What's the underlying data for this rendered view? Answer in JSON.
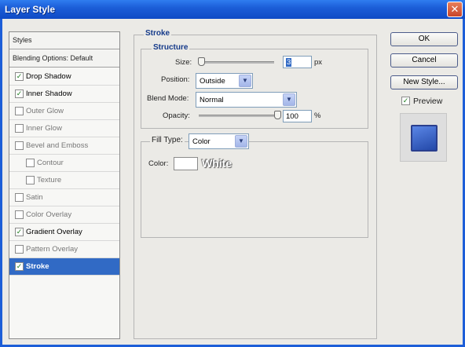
{
  "window": {
    "title": "Layer Style"
  },
  "styles_list": {
    "header": "Styles",
    "blending": "Blending Options: Default",
    "items": [
      {
        "label": "Drop Shadow",
        "checked": true
      },
      {
        "label": "Inner Shadow",
        "checked": true
      },
      {
        "label": "Outer Glow",
        "checked": false
      },
      {
        "label": "Inner Glow",
        "checked": false
      },
      {
        "label": "Bevel and Emboss",
        "checked": false
      },
      {
        "label": "Contour",
        "checked": false
      },
      {
        "label": "Texture",
        "checked": false
      },
      {
        "label": "Satin",
        "checked": false
      },
      {
        "label": "Color Overlay",
        "checked": false
      },
      {
        "label": "Gradient Overlay",
        "checked": true
      },
      {
        "label": "Pattern Overlay",
        "checked": false
      },
      {
        "label": "Stroke",
        "checked": true,
        "selected": true
      }
    ]
  },
  "stroke": {
    "section_title": "Stroke",
    "structure_title": "Structure",
    "size_label": "Size:",
    "size_value": "3",
    "size_unit": "px",
    "position_label": "Position:",
    "position_value": "Outside",
    "blend_label": "Blend Mode:",
    "blend_value": "Normal",
    "opacity_label": "Opacity:",
    "opacity_value": "100",
    "opacity_unit": "%",
    "opacity_level": 1.0,
    "size_level": 0.03,
    "fill_type_label": "Fill Type:",
    "fill_type_value": "Color",
    "color_label": "Color:",
    "color_swatch": "#ffffff",
    "color_annotation": "White"
  },
  "buttons": {
    "ok": "OK",
    "cancel": "Cancel",
    "new_style": "New Style...",
    "preview": "Preview",
    "preview_checked": true
  },
  "colors": {
    "title_bar": "#1c5ed8",
    "selection": "#316ac5",
    "preview_fill": "#3a62c8"
  }
}
